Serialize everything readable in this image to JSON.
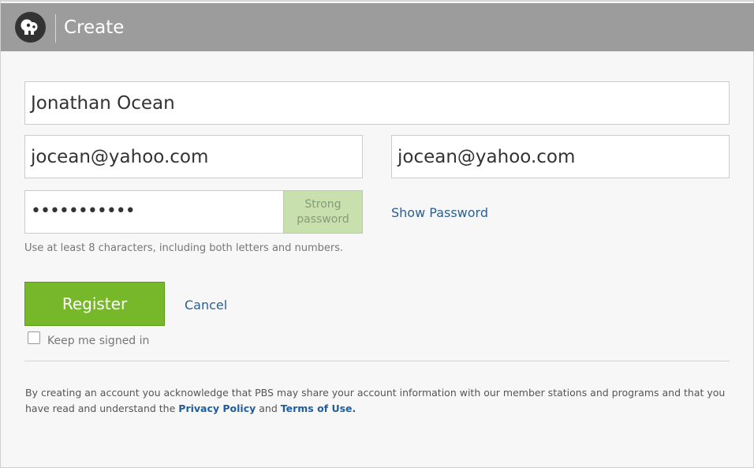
{
  "header": {
    "logo_icon": "pbs-logo-icon",
    "title": "Create",
    "background_color": "#9c9c9c"
  },
  "form": {
    "name_value": "Jonathan Ocean",
    "email_value": "jocean@yahoo.com",
    "email_confirm_value": "jocean@yahoo.com",
    "password_value": "•••••••••••",
    "password_strength_line1": "Strong",
    "password_strength_line2": "password",
    "show_password_label": "Show Password",
    "password_hint": "Use at least 8 characters, including both letters and numbers.",
    "register_label": "Register",
    "cancel_label": "Cancel",
    "keep_signed_in_label": "Keep me signed in",
    "keep_signed_in_checked": false
  },
  "legal": {
    "text_before": "By creating an account you acknowledge that PBS may share your account information with our member stations and programs and that you have read and understand the",
    "privacy_link": "Privacy Policy",
    "text_middle": "and",
    "terms_link": "Terms of Use."
  },
  "colors": {
    "accent_green": "#76b82a",
    "link_blue": "#2b5f94",
    "strength_green": "#c8dfae"
  }
}
